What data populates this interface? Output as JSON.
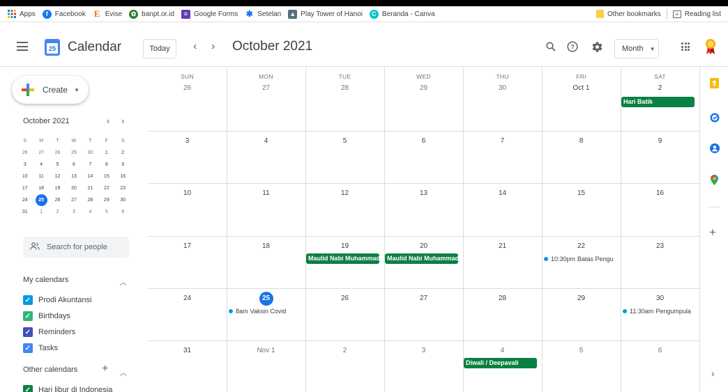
{
  "bookmarks": {
    "items": [
      {
        "label": "Apps",
        "icon": "apps-grid-icon",
        "color": "#1a73e8"
      },
      {
        "label": "Facebook",
        "icon": "facebook-icon",
        "color": "#1877f2"
      },
      {
        "label": "Evise",
        "icon": "evise-icon",
        "color": "#ff6a00"
      },
      {
        "label": "banpt.or.id",
        "icon": "banpt-icon",
        "color": "#2e7d32"
      },
      {
        "label": "Google Forms",
        "icon": "forms-icon",
        "color": "#673ab7"
      },
      {
        "label": "Setelan",
        "icon": "gear-icon",
        "color": "#1a73e8"
      },
      {
        "label": "Play Tower of Hanoi",
        "icon": "hanoi-icon",
        "color": "#546e7a"
      },
      {
        "label": "Beranda - Canva",
        "icon": "canva-icon",
        "color": "#00c4cc"
      }
    ],
    "other_bookmarks": "Other bookmarks",
    "reading_list": "Reading list"
  },
  "header": {
    "app_title": "Calendar",
    "logo_day": "25",
    "today_button": "Today",
    "prev_icon": "‹",
    "next_icon": "›",
    "month_title": "October 2021",
    "view_button": "Month"
  },
  "sidebar": {
    "create_label": "Create",
    "mini_title": "October 2021",
    "weekday_initials": [
      "S",
      "M",
      "T",
      "W",
      "T",
      "F",
      "S"
    ],
    "mini_weeks": [
      [
        "26",
        "27",
        "28",
        "29",
        "30",
        "1",
        "2"
      ],
      [
        "3",
        "4",
        "5",
        "6",
        "7",
        "8",
        "9"
      ],
      [
        "10",
        "11",
        "12",
        "13",
        "14",
        "15",
        "16"
      ],
      [
        "17",
        "18",
        "19",
        "20",
        "21",
        "22",
        "23"
      ],
      [
        "24",
        "25",
        "26",
        "27",
        "28",
        "29",
        "30"
      ],
      [
        "31",
        "1",
        "2",
        "3",
        "4",
        "5",
        "6"
      ]
    ],
    "search_people": "Search for people",
    "my_calendars_title": "My calendars",
    "my_calendars": [
      {
        "label": "Prodi Akuntansi",
        "color": "#039be5"
      },
      {
        "label": "Birthdays",
        "color": "#33b679"
      },
      {
        "label": "Reminders",
        "color": "#3f51b5"
      },
      {
        "label": "Tasks",
        "color": "#4285f4"
      }
    ],
    "other_calendars_title": "Other calendars",
    "other_calendars": [
      {
        "label": "Hari libur di Indonesia",
        "color": "#0b8043"
      }
    ]
  },
  "calendar": {
    "weekday_headers": [
      "SUN",
      "MON",
      "TUE",
      "WED",
      "THU",
      "FRI",
      "SAT"
    ],
    "weeks": [
      [
        "26",
        "27",
        "28",
        "29",
        "30",
        "Oct 1",
        "2"
      ],
      [
        "3",
        "4",
        "5",
        "6",
        "7",
        "8",
        "9"
      ],
      [
        "10",
        "11",
        "12",
        "13",
        "14",
        "15",
        "16"
      ],
      [
        "17",
        "18",
        "19",
        "20",
        "21",
        "22",
        "23"
      ],
      [
        "24",
        "25",
        "26",
        "27",
        "28",
        "29",
        "30"
      ],
      [
        "31",
        "Nov 1",
        "2",
        "3",
        "4",
        "5",
        "6"
      ]
    ],
    "all_day_events": [
      {
        "title": "Hari Batik",
        "week": 0,
        "day": 6,
        "color": "#0b8043"
      },
      {
        "title": "Maulid Nabi Muhammad",
        "week": 3,
        "day": 2,
        "color": "#0b8043"
      },
      {
        "title": "Maulid Nabi Muhammad",
        "week": 3,
        "day": 3,
        "color": "#0b8043"
      },
      {
        "title": "Diwali / Deepavali",
        "week": 5,
        "day": 4,
        "color": "#0b8043"
      }
    ],
    "timed_events": [
      {
        "time": "10:30pm",
        "title": "Batas Pengu",
        "week": 3,
        "day": 5,
        "color": "#039be5"
      },
      {
        "time": "8am",
        "title": "Vaksin Covid",
        "week": 4,
        "day": 1,
        "color": "#039be5"
      },
      {
        "time": "11:30am",
        "title": "Pengumpula",
        "week": 4,
        "day": 6,
        "color": "#039be5"
      }
    ]
  },
  "right_panel": {
    "icons": [
      "keep-icon",
      "tasks-icon",
      "contacts-icon",
      "maps-icon"
    ]
  }
}
